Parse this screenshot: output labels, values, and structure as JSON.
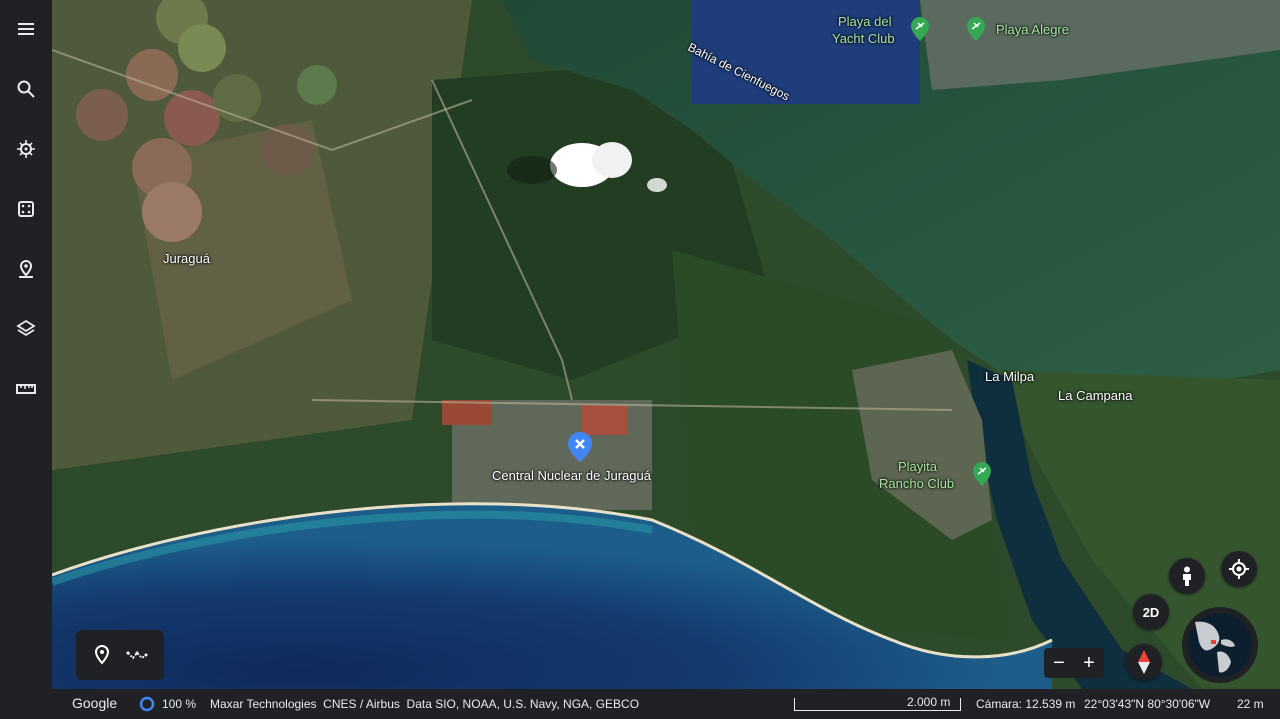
{
  "sidebar": {
    "items": [
      {
        "name": "menu-icon"
      },
      {
        "name": "search-icon"
      },
      {
        "name": "voyager-icon"
      },
      {
        "name": "dice-icon"
      },
      {
        "name": "projects-icon"
      },
      {
        "name": "layers-icon"
      },
      {
        "name": "ruler-icon"
      }
    ]
  },
  "map_labels": {
    "bahia": "Bahía de Cienfuegos",
    "yacht_line1": "Playa del",
    "yacht_line2": "Yacht Club",
    "playa_alegre": "Playa Alegre",
    "juragua": "Juraguá",
    "central": "Central Nuclear de Juraguá",
    "la_milpa": "La Milpa",
    "la_campana": "La Campana",
    "playita_line1": "Playita",
    "playita_line2": "Rancho Club"
  },
  "controls": {
    "mode_2d": "2D",
    "zoom_out": "−",
    "zoom_in": "+"
  },
  "status_bar": {
    "google": "Google",
    "progress": "100 %",
    "attribution": "Maxar Technologies  CNES / Airbus  Data SIO, NOAA, U.S. Navy, NGA, GEBCO",
    "scale": "2.000 m",
    "camera": "Cámara: 12.539 m",
    "coords": "22°03'43\"N 80°30'06\"W",
    "elevation": "22 m"
  },
  "colors": {
    "accent_blue": "#4285f4",
    "pin_green": "#34a853",
    "sidebar_bg": "#202124"
  }
}
